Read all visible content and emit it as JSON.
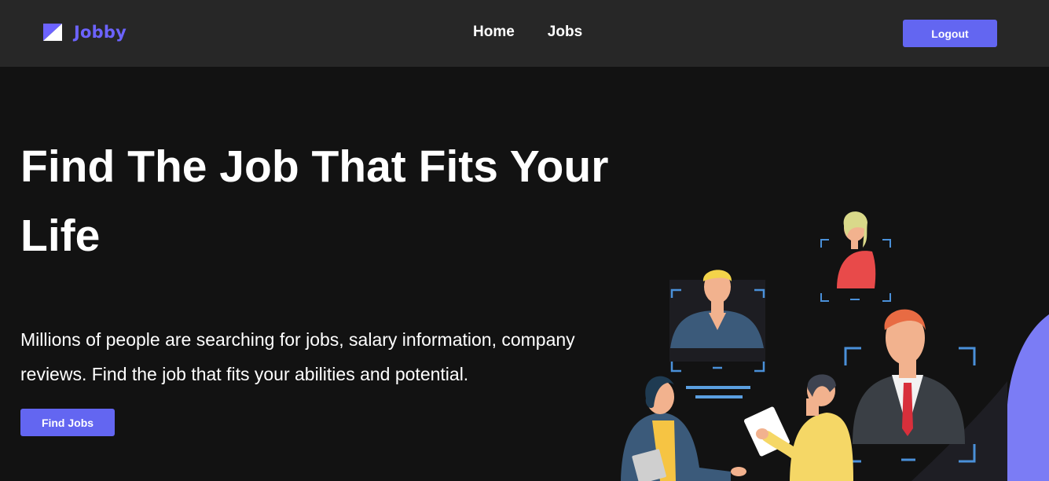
{
  "header": {
    "brand_name": "Jobby",
    "nav": [
      {
        "label": "Home"
      },
      {
        "label": "Jobs"
      }
    ],
    "logout_label": "Logout"
  },
  "hero": {
    "title": "Find The Job That Fits Your Life",
    "description": "Millions of people are searching for jobs, salary information, company reviews. Find the job that fits your abilities and potential.",
    "cta_label": "Find Jobs"
  },
  "colors": {
    "page_background": "#121212",
    "navbar_background": "#272727",
    "accent": "#6366f1",
    "brand_text": "#6c63ff"
  },
  "illustration": {
    "icon": "recruitment-people-illustration"
  }
}
